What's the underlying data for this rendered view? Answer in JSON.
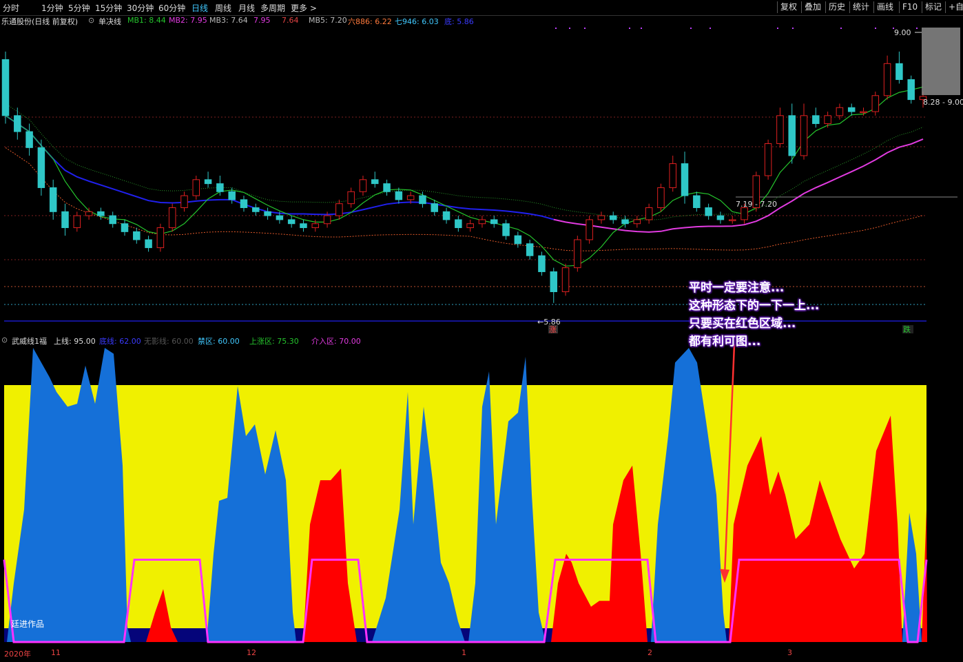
{
  "toolbar": {
    "periods": [
      "分时",
      "1分钟",
      "5分钟",
      "15分钟",
      "30分钟",
      "60分钟",
      "日线",
      "周线",
      "月线",
      "多周期",
      "更多 >"
    ],
    "active": "日线",
    "right_buttons": [
      "复权",
      "叠加",
      "历史",
      "统计",
      "画线",
      "F10",
      "标记",
      "+自选"
    ]
  },
  "main_legend": {
    "title": "乐通股份(日线 前复权)",
    "indicator": "单决线",
    "items": [
      {
        "label": "MB1: 8.44",
        "color": "#25c52d"
      },
      {
        "label": "MB2: 7.95",
        "color": "#e23be1"
      },
      {
        "label": "MB3: 7.64",
        "color": "#bbbbbb"
      },
      {
        "label": "7.95",
        "color": "#e23be1"
      },
      {
        "label": "7.64",
        "color": "#e44444"
      },
      {
        "label": "MB5: 7.20",
        "color": "#bbbbbb"
      },
      {
        "label": "六886: 6.22",
        "color": "#ff7a3c"
      },
      {
        "label": "七946: 6.03",
        "color": "#41c9ff"
      },
      {
        "label": "底: 5.86",
        "color": "#3a3aff"
      }
    ]
  },
  "price_labels": {
    "high": "9.00",
    "range_top": "8.28 - 9.00",
    "range_mid": "7.19 - 7.20",
    "low": "5.86",
    "rise_badge": "涨",
    "fall_badge": "跌"
  },
  "sub_legend": {
    "title": "武威线1福",
    "items": [
      {
        "label": "上线: 95.00",
        "color": "#dddddd"
      },
      {
        "label": "底线: 62.00",
        "color": "#3a3aff"
      },
      {
        "label": "无影线: 60.00",
        "color": "#555555"
      },
      {
        "label": "禁区: 60.00",
        "color": "#41c9ff"
      },
      {
        "label": "上涨区: 75.30",
        "color": "#25c52d"
      },
      {
        "label": "介入区: 70.00",
        "color": "#e23be1"
      }
    ]
  },
  "annotation": {
    "lines": [
      "平时一定要注意...",
      "这种形态下的一下一上...",
      "只要买在红色区域...",
      "都有利可图..."
    ]
  },
  "author": "廷进作品",
  "dates": [
    "2020年",
    "11",
    "12",
    "1",
    "2",
    "3"
  ],
  "colors": {
    "up": "#e02020",
    "down": "#2fc7c7",
    "ma_short": "#25c52d",
    "ma_mid": "#2020ee",
    "ma_long": "#e23be1",
    "zone_yellow": "#f0f000",
    "zone_blue": "#1570d8",
    "zone_red": "#ff0000",
    "zone_navy": "#05057a",
    "signal": "#ff30ff"
  },
  "chart_data": [
    {
      "type": "candlestick",
      "title": "乐通股份(日线 前复权)",
      "ylim": [
        5.6,
        9.3
      ],
      "candles": [
        [
          8.9,
          9.0,
          8.1,
          8.2
        ],
        [
          8.2,
          8.3,
          7.9,
          8.0
        ],
        [
          8.0,
          8.1,
          7.7,
          7.8
        ],
        [
          7.8,
          7.9,
          7.2,
          7.3
        ],
        [
          7.3,
          7.4,
          6.9,
          7.0
        ],
        [
          7.0,
          7.1,
          6.7,
          6.8
        ],
        [
          6.8,
          7.0,
          6.75,
          6.95
        ],
        [
          6.95,
          7.05,
          6.9,
          7.0
        ],
        [
          7.0,
          7.05,
          6.9,
          6.95
        ],
        [
          6.95,
          7.0,
          6.8,
          6.85
        ],
        [
          6.85,
          6.9,
          6.7,
          6.75
        ],
        [
          6.75,
          6.8,
          6.6,
          6.65
        ],
        [
          6.65,
          6.7,
          6.5,
          6.55
        ],
        [
          6.55,
          6.85,
          6.5,
          6.8
        ],
        [
          6.8,
          7.1,
          6.75,
          7.05
        ],
        [
          7.05,
          7.25,
          7.0,
          7.2
        ],
        [
          7.2,
          7.45,
          7.15,
          7.4
        ],
        [
          7.4,
          7.5,
          7.3,
          7.35
        ],
        [
          7.35,
          7.45,
          7.2,
          7.25
        ],
        [
          7.25,
          7.3,
          7.1,
          7.15
        ],
        [
          7.15,
          7.2,
          7.0,
          7.05
        ],
        [
          7.05,
          7.1,
          6.95,
          7.0
        ],
        [
          7.0,
          7.05,
          6.9,
          6.95
        ],
        [
          6.95,
          7.0,
          6.85,
          6.9
        ],
        [
          6.9,
          6.95,
          6.8,
          6.85
        ],
        [
          6.85,
          6.9,
          6.75,
          6.8
        ],
        [
          6.8,
          6.9,
          6.75,
          6.85
        ],
        [
          6.85,
          7.0,
          6.8,
          6.95
        ],
        [
          6.95,
          7.15,
          6.9,
          7.1
        ],
        [
          7.1,
          7.3,
          7.05,
          7.25
        ],
        [
          7.25,
          7.45,
          7.2,
          7.4
        ],
        [
          7.4,
          7.5,
          7.3,
          7.35
        ],
        [
          7.35,
          7.4,
          7.2,
          7.25
        ],
        [
          7.25,
          7.3,
          7.1,
          7.15
        ],
        [
          7.15,
          7.25,
          7.1,
          7.2
        ],
        [
          7.2,
          7.25,
          7.05,
          7.1
        ],
        [
          7.1,
          7.15,
          6.95,
          7.0
        ],
        [
          7.0,
          7.05,
          6.85,
          6.9
        ],
        [
          6.9,
          6.95,
          6.75,
          6.8
        ],
        [
          6.8,
          6.9,
          6.75,
          6.85
        ],
        [
          6.85,
          6.95,
          6.8,
          6.9
        ],
        [
          6.9,
          6.95,
          6.8,
          6.85
        ],
        [
          6.85,
          6.9,
          6.65,
          6.7
        ],
        [
          6.7,
          6.75,
          6.55,
          6.6
        ],
        [
          6.6,
          6.65,
          6.4,
          6.45
        ],
        [
          6.45,
          6.5,
          6.2,
          6.25
        ],
        [
          6.25,
          6.3,
          5.86,
          6.0
        ],
        [
          6.0,
          6.35,
          5.95,
          6.3
        ],
        [
          6.3,
          6.7,
          6.25,
          6.65
        ],
        [
          6.65,
          6.95,
          6.6,
          6.9
        ],
        [
          6.9,
          7.0,
          6.85,
          6.95
        ],
        [
          6.95,
          7.0,
          6.85,
          6.9
        ],
        [
          6.9,
          6.95,
          6.8,
          6.85
        ],
        [
          6.85,
          6.95,
          6.8,
          6.9
        ],
        [
          6.9,
          7.1,
          6.85,
          7.05
        ],
        [
          7.05,
          7.35,
          7.0,
          7.3
        ],
        [
          7.3,
          7.7,
          7.25,
          7.6
        ],
        [
          7.6,
          7.75,
          7.1,
          7.2
        ],
        [
          7.2,
          7.25,
          7.0,
          7.05
        ],
        [
          7.05,
          7.1,
          6.9,
          6.95
        ],
        [
          6.95,
          7.0,
          6.85,
          6.9
        ],
        [
          6.9,
          6.95,
          6.85,
          6.9
        ],
        [
          6.9,
          7.1,
          6.85,
          7.05
        ],
        [
          7.05,
          7.5,
          7.0,
          7.45
        ],
        [
          7.45,
          7.9,
          7.4,
          7.85
        ],
        [
          7.85,
          8.3,
          7.8,
          8.2
        ],
        [
          8.2,
          8.35,
          7.6,
          7.7
        ],
        [
          7.7,
          8.35,
          7.65,
          8.2
        ],
        [
          8.2,
          8.3,
          8.05,
          8.1
        ],
        [
          8.1,
          8.25,
          8.05,
          8.2
        ],
        [
          8.2,
          8.35,
          8.15,
          8.3
        ],
        [
          8.3,
          8.35,
          8.2,
          8.25
        ],
        [
          8.25,
          8.3,
          8.2,
          8.25
        ],
        [
          8.25,
          8.5,
          8.2,
          8.45
        ],
        [
          8.45,
          8.95,
          8.4,
          8.85
        ],
        [
          8.85,
          9.0,
          8.6,
          8.65
        ],
        [
          8.65,
          8.7,
          8.35,
          8.4
        ],
        [
          8.4,
          8.5,
          8.3,
          8.44
        ]
      ]
    },
    {
      "type": "area",
      "title": "武威线1福",
      "ylim": [
        0,
        100
      ],
      "levels": {
        "上线": 95.0,
        "底线": 62.0,
        "禁区": 60.0,
        "上涨区": 75.3,
        "介入区": 70.0
      }
    }
  ]
}
